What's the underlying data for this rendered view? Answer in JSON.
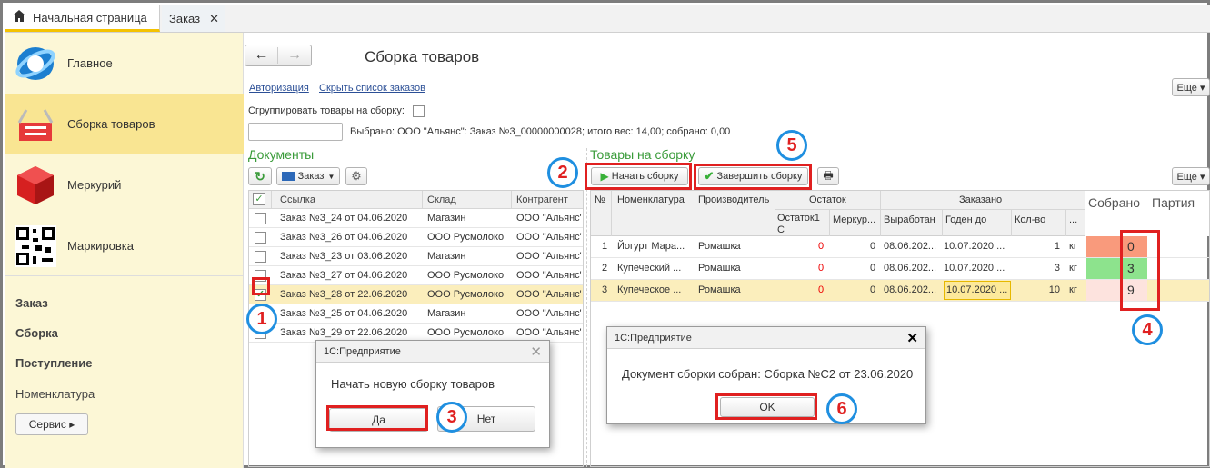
{
  "tabs": {
    "home": "Начальная страница",
    "order": "Заказ"
  },
  "sidebar": {
    "sections": [
      {
        "label": "Главное",
        "icon": "globe-icon"
      },
      {
        "label": "Сборка товаров",
        "icon": "basket-icon"
      },
      {
        "label": "Меркурий",
        "icon": "cube-icon"
      },
      {
        "label": "Маркировка",
        "icon": "qr-code-icon"
      }
    ],
    "nav": [
      "Заказ",
      "Сборка",
      "Поступление",
      "Номенклатура"
    ],
    "service_label": "Сервис ▸"
  },
  "page": {
    "title": "Сборка товаров",
    "link_auth": "Авторизация",
    "link_hide": "Скрыть список заказов",
    "group_label": "Сгруппировать товары на сборку:",
    "selected_text": "Выбрано:  ООО \"Альянс\": Заказ №3_00000000028; итого вес: 14,00; собрано: 0,00",
    "more_label": "Еще ▾"
  },
  "documents": {
    "title": "Документы",
    "order_btn": "Заказ",
    "columns": [
      "Ссылка",
      "Склад",
      "Контрагент"
    ],
    "rows": [
      {
        "ref": "Заказ №3_24 от 04.06.2020",
        "warehouse": "Магазин",
        "partner": "ООО \"Альянс\"",
        "checked": false
      },
      {
        "ref": "Заказ №3_26 от 04.06.2020",
        "warehouse": "ООО Русмолоко",
        "partner": "ООО \"Альянс\"",
        "checked": false
      },
      {
        "ref": "Заказ №3_23 от 03.06.2020",
        "warehouse": "Магазин",
        "partner": "ООО \"Альянс\"",
        "checked": false
      },
      {
        "ref": "Заказ №3_27 от 04.06.2020",
        "warehouse": "ООО Русмолоко",
        "partner": "ООО \"Альянс\"",
        "checked": false
      },
      {
        "ref": "Заказ №3_28 от 22.06.2020",
        "warehouse": "ООО Русмолоко",
        "partner": "ООО \"Альянс\"",
        "checked": true
      },
      {
        "ref": "Заказ №3_25 от 04.06.2020",
        "warehouse": "Магазин",
        "partner": "ООО \"Альянс\"",
        "checked": false
      },
      {
        "ref": "Заказ №3_29 от 22.06.2020",
        "warehouse": "ООО Русмолоко",
        "partner": "ООО \"Альянс\"",
        "checked": false
      }
    ]
  },
  "goods": {
    "title": "Товары на сборку",
    "start_btn": "Начать  сборку",
    "finish_btn": "Завершить  сборку",
    "hdr": {
      "num": "№",
      "nom": "Номенклатура",
      "maker": "Производитель",
      "rest": "Остаток",
      "rest1c": "Остаток1 С",
      "merc": "Меркур...",
      "ordered": "Заказано",
      "made": "Выработан",
      "until": "Годен до",
      "qty": "Кол-во",
      "dots": "...",
      "collected": "Собрано",
      "batch": "Партия"
    },
    "rows": [
      {
        "n": "1",
        "nom": "Йогурт Мара...",
        "maker": "Ромашка",
        "r1": "0",
        "r2": "0",
        "made": "08.06.202...",
        "until": "10.07.2020 ...",
        "qty": "1",
        "unit": "кг",
        "collected": "0"
      },
      {
        "n": "2",
        "nom": "Купеческий ...",
        "maker": "Ромашка",
        "r1": "0",
        "r2": "0",
        "made": "08.06.202...",
        "until": "10.07.2020 ...",
        "qty": "3",
        "unit": "кг",
        "collected": "3"
      },
      {
        "n": "3",
        "nom": "Купеческое ...",
        "maker": "Ромашка",
        "r1": "0",
        "r2": "0",
        "made": "08.06.202...",
        "until": "10.07.2020 ...",
        "qty": "10",
        "unit": "кг",
        "collected": "9"
      }
    ]
  },
  "dialog1": {
    "title": "1С:Предприятие",
    "text": "Начать новую сборку товаров",
    "yes": "Да",
    "no": "Нет"
  },
  "dialog2": {
    "title": "1С:Предприятие",
    "text": "Документ сборки собран: Сборка №С2 от 23.06.2020",
    "ok": "OK"
  },
  "steps": [
    "1",
    "2",
    "3",
    "4",
    "5",
    "6"
  ]
}
